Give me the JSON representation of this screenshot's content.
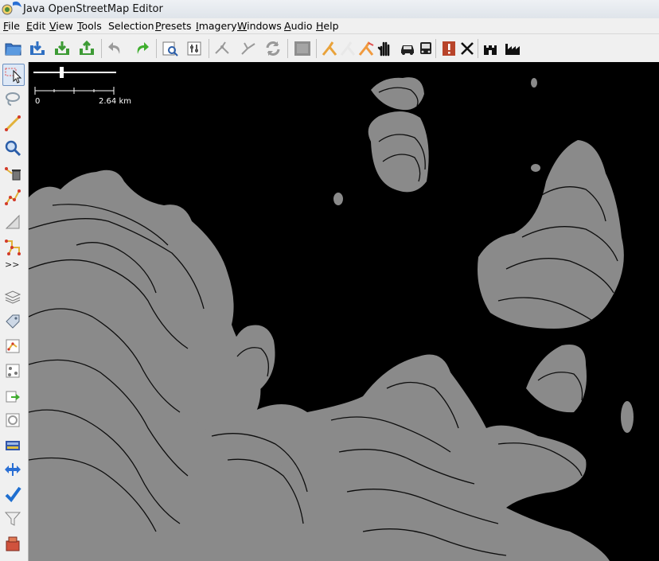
{
  "window": {
    "title": "Java OpenStreetMap Editor"
  },
  "menu": [
    {
      "key": "F",
      "rest": "ile"
    },
    {
      "key": "E",
      "rest": "dit"
    },
    {
      "key": "V",
      "rest": "iew"
    },
    {
      "key": "T",
      "rest": "ools"
    },
    {
      "key": "",
      "rest": "Selection"
    },
    {
      "key": "P",
      "rest": "resets"
    },
    {
      "key": "I",
      "rest": "magery"
    },
    {
      "key": "W",
      "rest": "indows"
    },
    {
      "key": "A",
      "rest": "udio"
    },
    {
      "key": "H",
      "rest": "elp"
    }
  ],
  "toolbar_icons": [
    "open-icon",
    "save-icon",
    "download-icon",
    "upload-icon",
    "undo-icon",
    "redo-icon",
    "zoom-data-icon",
    "preferences-icon",
    "split-way-icon",
    "combine-way-icon",
    "update-data-icon",
    "blank-layer-icon",
    "highway-preset-icon",
    "path-preset-icon",
    "railway-preset-icon",
    "hand-icon",
    "car-icon",
    "bus-icon",
    "warning-icon",
    "cross-tools-icon",
    "castle-icon",
    "industry-icon"
  ],
  "left_tools": [
    "select-icon",
    "lasso-icon",
    "draw-icon",
    "zoom-icon",
    "delete-icon",
    "improve-way-icon",
    "parallel-icon",
    "extrude-icon"
  ],
  "left_panels": [
    "layers-icon",
    "tags-icon",
    "selection-list-icon",
    "relations-icon",
    "history-icon",
    "conflict-icon",
    "notes-icon",
    "validation-icon",
    "check-icon",
    "filter-icon",
    "changeset-icon"
  ],
  "left_tools_more": ">>",
  "map": {
    "scale_zero": "0",
    "scale_max": "2.64 km",
    "zoom_level": 0.33,
    "background": "#000000",
    "contour_color": "#8a8a8a"
  }
}
